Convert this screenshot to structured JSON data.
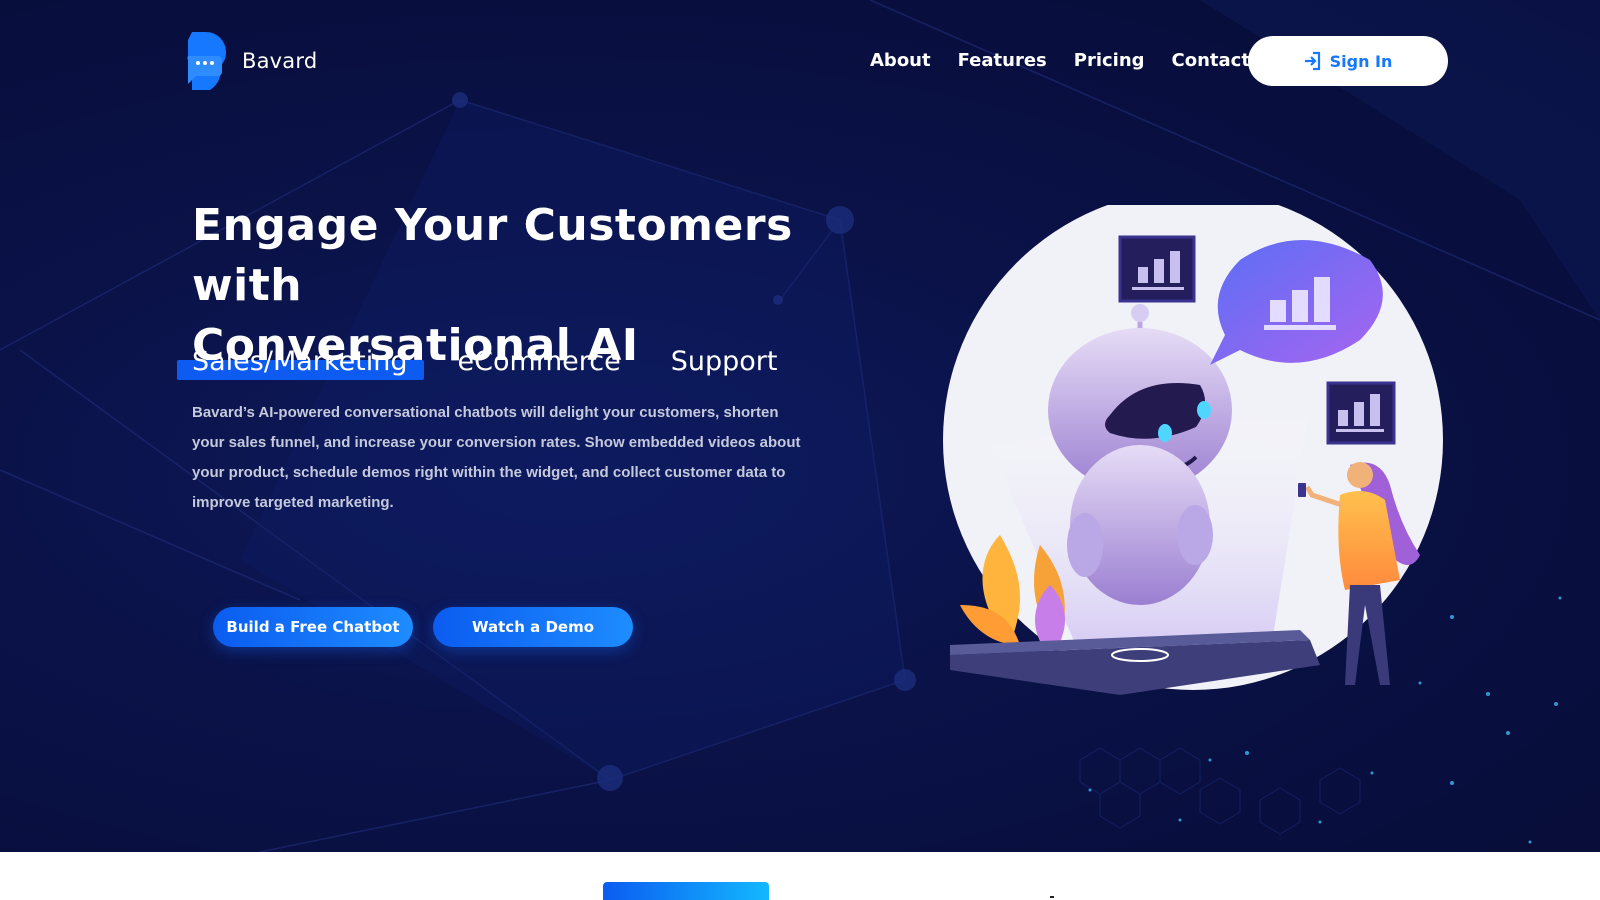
{
  "brand": {
    "name": "Bavard",
    "logo_icon": "chat-bubble-logo-icon"
  },
  "nav": {
    "items": [
      {
        "label": "About"
      },
      {
        "label": "Features"
      },
      {
        "label": "Pricing"
      },
      {
        "label": "Contact"
      }
    ],
    "signin_label": "Sign In",
    "signin_icon": "sign-in-arrow-icon"
  },
  "hero": {
    "headline_line1": "Engage Your Customers with",
    "headline_line2": "Conversational AI",
    "tabs": [
      {
        "label": "Sales/Marketing",
        "active": true
      },
      {
        "label": "eCommerce",
        "active": false
      },
      {
        "label": "Support",
        "active": false
      }
    ],
    "description": "Bavard’s AI-powered conversational chatbots will delight your customers, shorten your sales funnel, and increase your conversion rates. Show embedded videos about your product, schedule demos right within the widget, and collect customer data to improve targeted marketing.",
    "cta_primary": "Build a Free Chatbot",
    "cta_secondary": "Watch a Demo"
  },
  "colors": {
    "background": "#0a1248",
    "accent": "#1677ff",
    "tab_highlight": "#0d5bf0"
  }
}
